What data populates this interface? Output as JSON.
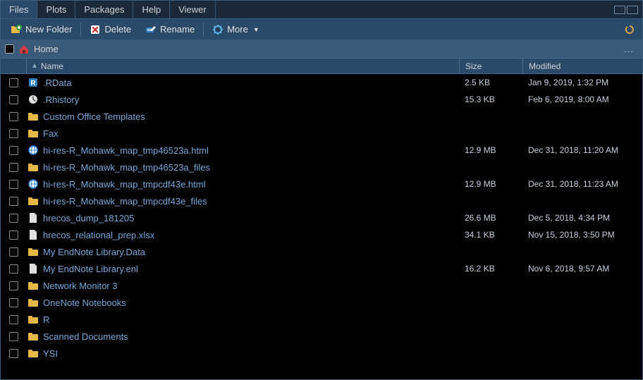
{
  "tabs": [
    "Files",
    "Plots",
    "Packages",
    "Help",
    "Viewer"
  ],
  "active_tab": 0,
  "toolbar": {
    "new_folder": "New Folder",
    "delete": "Delete",
    "rename": "Rename",
    "more": "More"
  },
  "breadcrumb": {
    "home": "Home"
  },
  "headers": {
    "name": "Name",
    "size": "Size",
    "modified": "Modified"
  },
  "rows": [
    {
      "icon": "rdata",
      "name": ".RData",
      "size": "2.5 KB",
      "modified": "Jan 9, 2019, 1:32 PM",
      "link": true
    },
    {
      "icon": "rhist",
      "name": ".Rhistory",
      "size": "15.3 KB",
      "modified": "Feb 6, 2019, 8:00 AM",
      "link": true
    },
    {
      "icon": "folder",
      "name": "Custom Office Templates",
      "size": "",
      "modified": "",
      "link": true
    },
    {
      "icon": "folder",
      "name": "Fax",
      "size": "",
      "modified": "",
      "link": true
    },
    {
      "icon": "html",
      "name": "hi-res-R_Mohawk_map_tmp46523a.html",
      "size": "12.9 MB",
      "modified": "Dec 31, 2018, 11:20 AM",
      "link": true
    },
    {
      "icon": "folder",
      "name": "hi-res-R_Mohawk_map_tmp46523a_files",
      "size": "",
      "modified": "",
      "link": true
    },
    {
      "icon": "html",
      "name": "hi-res-R_Mohawk_map_tmpcdf43e.html",
      "size": "12.9 MB",
      "modified": "Dec 31, 2018, 11:23 AM",
      "link": true
    },
    {
      "icon": "folder",
      "name": "hi-res-R_Mohawk_map_tmpcdf43e_files",
      "size": "",
      "modified": "",
      "link": true
    },
    {
      "icon": "file",
      "name": "hrecos_dump_181205",
      "size": "26.6 MB",
      "modified": "Dec 5, 2018, 4:34 PM",
      "link": true
    },
    {
      "icon": "file",
      "name": "hrecos_relational_prep.xlsx",
      "size": "34.1 KB",
      "modified": "Nov 15, 2018, 3:50 PM",
      "link": true
    },
    {
      "icon": "folder",
      "name": "My EndNote Library.Data",
      "size": "",
      "modified": "",
      "link": true
    },
    {
      "icon": "file",
      "name": "My EndNote Library.enl",
      "size": "16.2 KB",
      "modified": "Nov 6, 2018, 9:57 AM",
      "link": true
    },
    {
      "icon": "folder",
      "name": "Network Monitor 3",
      "size": "",
      "modified": "",
      "link": true
    },
    {
      "icon": "folder",
      "name": "OneNote Notebooks",
      "size": "",
      "modified": "",
      "link": true
    },
    {
      "icon": "folder",
      "name": "R",
      "size": "",
      "modified": "",
      "link": true
    },
    {
      "icon": "folder",
      "name": "Scanned Documents",
      "size": "",
      "modified": "",
      "link": true
    },
    {
      "icon": "folder",
      "name": "YSI",
      "size": "",
      "modified": "",
      "link": true
    }
  ]
}
